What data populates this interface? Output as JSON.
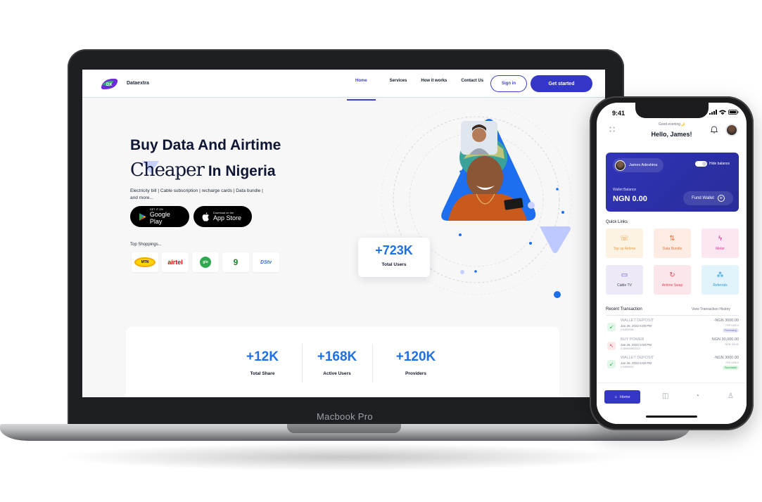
{
  "laptop": {
    "brand_label": "Macbook Pro"
  },
  "site": {
    "brand": {
      "logo_text": "DX",
      "name": "Dataextra"
    },
    "nav": [
      {
        "label": "Home",
        "active": true
      },
      {
        "label": "Services",
        "active": false
      },
      {
        "label": "How it works",
        "active": false
      },
      {
        "label": "Contact Us",
        "active": false
      }
    ],
    "signin_label": "Sign in",
    "get_started_label": "Get started",
    "hero": {
      "title_line1": "Buy Data And Airtime",
      "title_cheaper": "Cheaper",
      "title_rest": " In Nigeria",
      "subtitle": "Electricity bill | Cable subscription | recharge cards | Data bundle | and more...",
      "google_play_small": "GET IT ON",
      "google_play_big": "Google Play",
      "app_store_small": "Download on the",
      "app_store_big": "App Store",
      "top_shoppings_label": "Top Shoppings...",
      "shops": [
        "MTN",
        "airtel",
        "glo",
        "9",
        "DStv"
      ]
    },
    "total_users": {
      "value": "+723K",
      "label": "Total Users"
    },
    "stats": [
      {
        "value": "+12K",
        "label": "Total Share"
      },
      {
        "value": "+168K",
        "label": "Active Users"
      },
      {
        "value": "+120K",
        "label": "Providers"
      }
    ],
    "colors": {
      "primary": "#3436c8",
      "accent_blue": "#1f6fe5",
      "hero_triangle": "#1e6ef0"
    }
  },
  "phone": {
    "status": {
      "time": "9:41"
    },
    "greeting_small": "Good evening🌙",
    "greeting": "Hello, James!",
    "wallet": {
      "user_name": "James Adeshina",
      "hide_balance_label": "Hide balance",
      "balance_label": "Wallet Balance",
      "balance": "NGN 0.00",
      "fund_label": "Fund Wallet"
    },
    "quick_links_title": "Quick Links",
    "quick_links": [
      {
        "label": "Top up Airtime",
        "icon": "phone-icon",
        "glyph": "☏",
        "bg": "#fdf3e4",
        "fg": "#e69a3b"
      },
      {
        "label": "Data Bundle",
        "icon": "swap-vertical-icon",
        "glyph": "⇅",
        "bg": "#fdece3",
        "fg": "#e0743e"
      },
      {
        "label": "Meter",
        "icon": "lightning-icon",
        "glyph": "ϟ",
        "bg": "#fbe6f2",
        "fg": "#d6338f"
      },
      {
        "label": "Cable TV",
        "icon": "tv-icon",
        "glyph": "▭",
        "bg": "#ede9f7",
        "fg": "#6b4fbf"
      },
      {
        "label": "Airtime Swap",
        "icon": "refresh-icon",
        "glyph": "↻",
        "bg": "#fbe7ea",
        "fg": "#e0455a"
      },
      {
        "label": "Referrals",
        "icon": "network-icon",
        "glyph": "⁂",
        "bg": "#e3f3fb",
        "fg": "#1c9bd6"
      }
    ],
    "recent_title": "Recent Transaction",
    "view_history_label": "View Transaction History",
    "transactions": [
      {
        "name": "WALLET DEPOSIT",
        "date": "Jan 26, 2022 6:00 PM",
        "ref": "# 64890926",
        "amount": "-NGN 3000.00",
        "fee": "FEE NGN 0",
        "status": "Processing",
        "dir": "in"
      },
      {
        "name": "BUY POWER",
        "date": "Jan 26, 2022 6:00 PM",
        "ref": "# 2895438402319",
        "amount": "NGN 30,000.00",
        "fee": "NGN 150.00",
        "status": "",
        "dir": "out"
      },
      {
        "name": "WALLET DEPOSIT",
        "date": "Jan 26, 2022 6:00 PM",
        "ref": "# 64890926",
        "amount": "-NGN 3000.00",
        "fee": "FEE NGN 0",
        "status": "Successful",
        "dir": "in"
      }
    ],
    "tabs": {
      "home_label": "Home"
    }
  }
}
